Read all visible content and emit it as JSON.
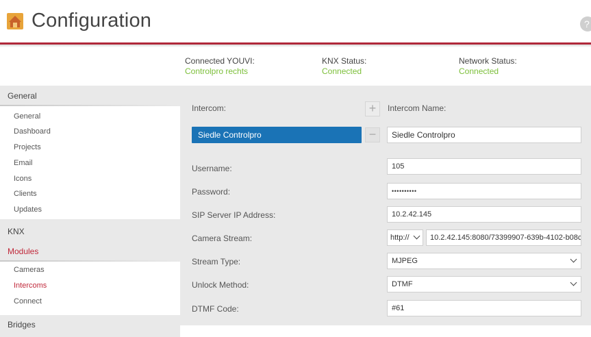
{
  "header": {
    "title": "Configuration",
    "help_glyph": "?",
    "accent_color": "#b0283a",
    "logo_icon": "house-icon",
    "help_icon": "help-icon"
  },
  "status": {
    "youvi_label": "Connected YOUVI:",
    "youvi_value": "Controlpro rechts",
    "knx_label": "KNX Status:",
    "knx_value": "Connected",
    "network_label": "Network Status:",
    "network_value": "Connected",
    "value_color": "#7cbf3a"
  },
  "sidebar": {
    "sections": {
      "general": {
        "title": "General",
        "items": [
          "General",
          "Dashboard",
          "Projects",
          "Email",
          "Icons",
          "Clients",
          "Updates"
        ]
      },
      "knx": {
        "title": "KNX"
      },
      "modules": {
        "title": "Modules",
        "items": [
          "Cameras",
          "Intercoms",
          "Connect"
        ],
        "active_item": "Intercoms"
      },
      "bridges": {
        "title": "Bridges"
      }
    }
  },
  "form": {
    "intercom_label": "Intercom:",
    "add_glyph": "+",
    "remove_glyph": "−",
    "intercom_name_label": "Intercom Name:",
    "intercom_selected": "Siedle Controlpro",
    "intercom_name_value": "Siedle Controlpro",
    "username_label": "Username:",
    "username_value": "105",
    "password_label": "Password:",
    "password_value": "••••••••••",
    "sip_label": "SIP Server IP Address:",
    "sip_value": "10.2.42.145",
    "camera_label": "Camera Stream:",
    "camera_scheme": "http://",
    "camera_url": "10.2.42.145:8080/73399907-639b-4102-b08c",
    "stream_type_label": "Stream Type:",
    "stream_type_value": "MJPEG",
    "unlock_label": "Unlock Method:",
    "unlock_value": "DTMF",
    "dtmf_label": "DTMF Code:",
    "dtmf_value": "#61",
    "selected_color": "#1a73b6"
  }
}
